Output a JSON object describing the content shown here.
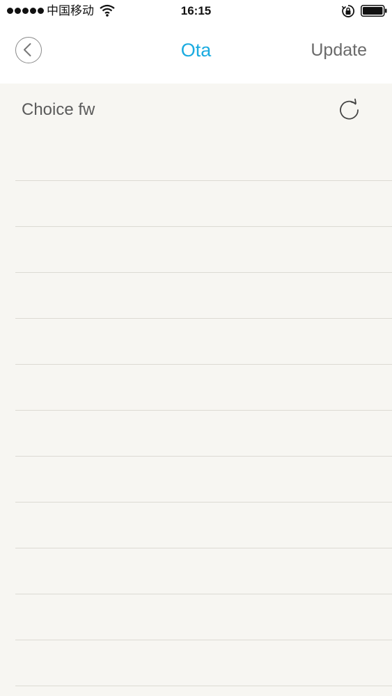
{
  "status_bar": {
    "carrier": "中国移动",
    "time": "16:15",
    "icons": [
      "signal-dots-icon",
      "wifi-icon",
      "rotation-lock-icon",
      "battery-icon"
    ]
  },
  "nav": {
    "title": "Ota",
    "update_label": "Update",
    "back_icon": "chevron-left-icon",
    "title_color": "#1aabe0"
  },
  "header": {
    "label": "Choice fw",
    "refresh_icon": "refresh-icon"
  },
  "firmware_list": {
    "rows": [
      "",
      "",
      "",
      "",
      "",
      "",
      "",
      "",
      "",
      "",
      "",
      ""
    ]
  }
}
